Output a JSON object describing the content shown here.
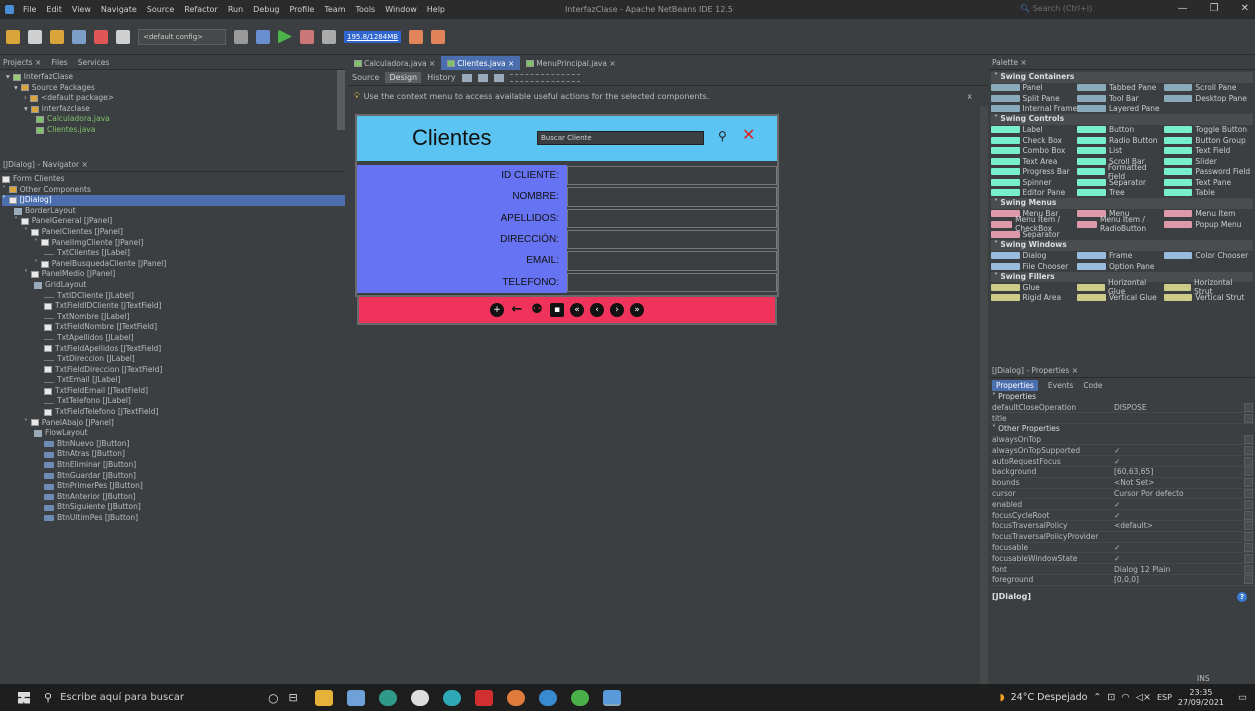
{
  "titlebar": {
    "menus": [
      "File",
      "Edit",
      "View",
      "Navigate",
      "Source",
      "Refactor",
      "Run",
      "Debug",
      "Profile",
      "Team",
      "Tools",
      "Window",
      "Help"
    ],
    "title": "InterfazClase - Apache NetBeans IDE 12.5",
    "search_placeholder": "Search (Ctrl+I)"
  },
  "toolbar": {
    "config": "<default config>",
    "memory": "195.8/1284MB"
  },
  "projects": {
    "tabs": [
      "Projects ×",
      "Files",
      "Services"
    ],
    "tree": [
      "InterfazClase",
      "Source Packages",
      "<default package>",
      "interfazclase",
      "Calculadora.java",
      "Clientes.java"
    ]
  },
  "navigator": {
    "title": "[JDialog] - Navigator ×",
    "items": [
      "Form Clientes",
      "Other Components",
      "[JDialog]",
      "BorderLayout",
      "PanelGeneral [JPanel]",
      "PanelClientes [JPanel]",
      "PanelImgCliente [JPanel]",
      "TxtClientes [JLabel]",
      "PanelBusquedaCliente [JPanel]",
      "PanelMedio [JPanel]",
      "GridLayout",
      "TxtIDCliente [JLabel]",
      "TxtFieldIDCliente [JTextField]",
      "TxtNombre [JLabel]",
      "TxtFieldNombre [JTextField]",
      "TxtApellidos [JLabel]",
      "TxtFieldApellidos [JTextField]",
      "TxtDireccion [JLabel]",
      "TxtFieldDireccion [JTextField]",
      "TxtEmail [JLabel]",
      "TxtFieldEmail [JTextField]",
      "TxtTelefono [JLabel]",
      "TxtFieldTelefono [JTextField]",
      "PanelAbajo [JPanel]",
      "FlowLayout",
      "BtnNuevo [JButton]",
      "BtnAtras [JButton]",
      "BtnEliminar [JButton]",
      "BtnGuardar [JButton]",
      "BtnPrimerPes [JButton]",
      "BtnAnterior [JButton]",
      "BtnSiguiente [JButton]",
      "BtnUltimPes [JButton]"
    ]
  },
  "editor": {
    "tabs": [
      "Calculadora.java ×",
      "Clientes.java ×",
      "MenuPrincipal.java ×"
    ],
    "modes": [
      "Source",
      "Design",
      "History"
    ],
    "hint": "Use the context menu to access available useful actions for the selected components.",
    "hint_close": "x"
  },
  "form": {
    "title": "Clientes",
    "search_value": "Buscar Cliente",
    "fields": [
      "ID CLIENTE:",
      "NOMBRE:",
      "APELLIDOS:",
      "DIRECCIÓN:",
      "EMAIL:",
      "TELEFONO:"
    ],
    "colors": {
      "header": "#5bc4f2",
      "labels": "#6673f2",
      "footer": "#f0335a"
    }
  },
  "palette": {
    "title": "Palette ×",
    "groups": [
      {
        "name": "Swing Containers",
        "items": [
          "Panel",
          "Tabbed Pane",
          "Scroll Pane",
          "Split Pane",
          "Tool Bar",
          "Desktop Pane",
          "Internal Frame",
          "Layered Pane"
        ]
      },
      {
        "name": "Swing Controls",
        "items": [
          "Label",
          "Button",
          "Toggle Button",
          "Check Box",
          "Radio Button",
          "Button Group",
          "Combo Box",
          "List",
          "Text Field",
          "Text Area",
          "Scroll Bar",
          "Slider",
          "Progress Bar",
          "Formatted Field",
          "Password Field",
          "Spinner",
          "Separator",
          "Text Pane",
          "Editor Pane",
          "Tree",
          "Table"
        ]
      },
      {
        "name": "Swing Menus",
        "items": [
          "Menu Bar",
          "Menu",
          "Menu Item",
          "Menu Item / CheckBox",
          "Menu Item / RadioButton",
          "Popup Menu",
          "Separator"
        ]
      },
      {
        "name": "Swing Windows",
        "items": [
          "Dialog",
          "Frame",
          "Color Chooser",
          "File Chooser",
          "Option Pane"
        ]
      },
      {
        "name": "Swing Fillers",
        "items": [
          "Glue",
          "Horizontal Glue",
          "Horizontal Strut",
          "Rigid Area",
          "Vertical Glue",
          "Vertical Strut"
        ]
      }
    ]
  },
  "properties": {
    "title": "[JDialog] - Properties ×",
    "tabs": [
      "Properties",
      "Events",
      "Code"
    ],
    "group1": "Properties",
    "group2": "Other Properties",
    "rows1": [
      {
        "k": "defaultCloseOperation",
        "v": "DISPOSE"
      },
      {
        "k": "title",
        "v": ""
      }
    ],
    "rows2": [
      {
        "k": "alwaysOnTop",
        "v": ""
      },
      {
        "k": "alwaysOnTopSupported",
        "v": "✓"
      },
      {
        "k": "autoRequestFocus",
        "v": "✓"
      },
      {
        "k": "background",
        "v": "[60,63,65]"
      },
      {
        "k": "bounds",
        "v": "<Not Set>"
      },
      {
        "k": "cursor",
        "v": "Cursor Por defecto"
      },
      {
        "k": "enabled",
        "v": "✓"
      },
      {
        "k": "focusCycleRoot",
        "v": "✓"
      },
      {
        "k": "focusTraversalPolicy",
        "v": "<default>"
      },
      {
        "k": "focusTraversalPolicyProvider",
        "v": ""
      },
      {
        "k": "focusable",
        "v": "✓"
      },
      {
        "k": "focusableWindowState",
        "v": "✓"
      },
      {
        "k": "font",
        "v": "Dialog 12 Plain"
      },
      {
        "k": "foreground",
        "v": "[0,0,0]"
      }
    ],
    "footer": "[JDialog]"
  },
  "statusbar": {
    "mode": "INS"
  },
  "taskbar": {
    "search_placeholder": "Escribe aquí para buscar",
    "weather": "24°C Despejado",
    "lang": "ESP",
    "time": "23:35",
    "date": "27/09/2021"
  }
}
